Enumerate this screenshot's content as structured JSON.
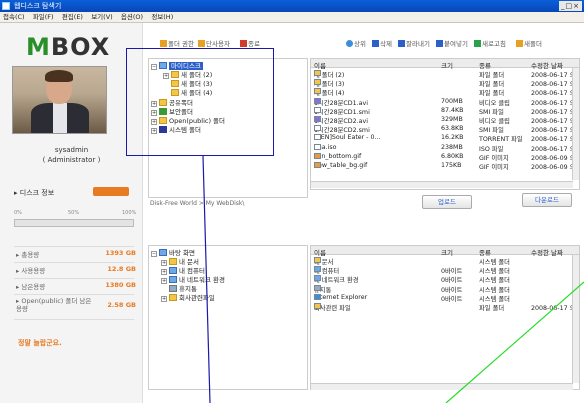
{
  "window": {
    "title": "웹디스크 탐색기",
    "controls": "_□×"
  },
  "menu": [
    "접속(C)",
    "파일(F)",
    "편집(E)",
    "보기(V)",
    "옵션(O)",
    "정보(H)"
  ],
  "sidebar": {
    "logo": "M BOX",
    "logo_m": "M",
    "logo_rest": "BOX",
    "username": "sysadmin",
    "role": "( Administrator )",
    "disk_info_label": "디스크 정보",
    "disk_info_badge": "",
    "gauge_ticks": [
      "0%",
      "50%",
      "100%"
    ],
    "gauge_fill_fraction": 0.0,
    "stats": [
      {
        "label": "총용량",
        "value": "1393 GB"
      },
      {
        "label": "사용용량",
        "value": "12.8 GB"
      },
      {
        "label": "남은용량",
        "value": "1380 GB"
      },
      {
        "label": "Open(public) 폴더 남은용량",
        "value": "2.58 GB"
      }
    ],
    "promo": "정말 놀랍군요."
  },
  "toolbar": {
    "items": [
      {
        "label": "폴더 권한",
        "icon": "folder-key-icon",
        "color": "#e8a020"
      },
      {
        "label": "단사용자",
        "icon": "user-icon",
        "color": "#e8a020"
      },
      {
        "label": "종료",
        "icon": "exit-icon",
        "color": "#d23a2a"
      },
      {
        "label": "상위",
        "icon": "up-icon",
        "color": "#3a8fd8"
      },
      {
        "label": "삭제",
        "icon": "delete-icon",
        "color": "#2b5fc9"
      },
      {
        "label": "잘라내기",
        "icon": "cut-icon",
        "color": "#2b5fc9"
      },
      {
        "label": "붙여넣기",
        "icon": "paste-icon",
        "color": "#2b5fc9"
      },
      {
        "label": "새로고침",
        "icon": "refresh-icon",
        "color": "#2ba04a"
      },
      {
        "label": "새폴더",
        "icon": "new-folder-icon",
        "color": "#e8a020"
      }
    ]
  },
  "remote_tree": {
    "items": [
      {
        "label": "마이디스크",
        "level": 0,
        "selected": true,
        "icon": "drive-icon"
      },
      {
        "label": "새 폴더 (2)",
        "level": 1,
        "icon": "folder-icon"
      },
      {
        "label": "새 폴더 (3)",
        "level": 1,
        "icon": "folder-icon"
      },
      {
        "label": "새 폴더 (4)",
        "level": 1,
        "icon": "folder-icon"
      },
      {
        "label": "공유폭더",
        "level": 0,
        "icon": "shared-folder-icon"
      },
      {
        "label": "보안폴더",
        "level": 0,
        "icon": "secure-folder-icon"
      },
      {
        "label": "Open(public) 폴더",
        "level": 0,
        "icon": "public-folder-icon"
      },
      {
        "label": "시스템 폴더",
        "level": 0,
        "icon": "system-folder-icon"
      }
    ]
  },
  "remote_files": {
    "headers": [
      "이름",
      "크기",
      "종류",
      "수정한 날짜"
    ],
    "rows": [
      {
        "name": "새 폴더 (2)",
        "size": "",
        "type": "파일 폴더",
        "date": "2008-06-17 오",
        "icon": "folder-icon"
      },
      {
        "name": "새 폴더 (3)",
        "size": "",
        "type": "파일 폴더",
        "date": "2008-06-17 오",
        "icon": "folder-icon"
      },
      {
        "name": "새 폴더 (4)",
        "size": "",
        "type": "파일 폴더",
        "date": "2008-06-17 오",
        "icon": "folder-icon"
      },
      {
        "name": "1시간28분CD1.avi",
        "size": "700MB",
        "type": "비디오 클립",
        "date": "2008-06-17 오",
        "icon": "video-icon"
      },
      {
        "name": "1시간28분CD1.smi",
        "size": "87.4KB",
        "type": "SMI 파일",
        "date": "2008-06-17 오",
        "icon": "file-icon"
      },
      {
        "name": "1시간28분CD2.avi",
        "size": "329MB",
        "type": "비디오 클립",
        "date": "2008-06-17 오",
        "icon": "video-icon"
      },
      {
        "name": "1시간28분CD2.smi",
        "size": "63.8KB",
        "type": "SMI 파일",
        "date": "2008-06-17 오",
        "icon": "file-icon"
      },
      {
        "name": "[AEN]Soul Eater - 0...",
        "size": "16.2KB",
        "type": "TORRENT 파일",
        "date": "2008-06-17 오",
        "icon": "file-icon"
      },
      {
        "name": "aaa.iso",
        "size": "238MB",
        "type": "ISO 파일",
        "date": "2008-06-17 오",
        "icon": "file-icon"
      },
      {
        "name": "con_bottom.gif",
        "size": "6.80KB",
        "type": "GIF 이미지",
        "date": "2008-06-09 오",
        "icon": "image-icon"
      },
      {
        "name": "new_table_bg.gif",
        "size": "175KB",
        "type": "GIF 이미지",
        "date": "2008-06-09 오",
        "icon": "image-icon"
      }
    ]
  },
  "path_label": "Disk-Free World > My WebDisk\\",
  "upload_label": "업로드",
  "download_label": "다운로드",
  "local_tree": {
    "items": [
      {
        "label": "바탕 화면",
        "level": 0,
        "icon": "desktop-icon"
      },
      {
        "label": "내 문서",
        "level": 1,
        "icon": "my-documents-icon"
      },
      {
        "label": "내 컴퓨터",
        "level": 1,
        "icon": "my-computer-icon"
      },
      {
        "label": "내 네트워크 환경",
        "level": 1,
        "icon": "network-icon"
      },
      {
        "label": "휴지통",
        "level": 1,
        "icon": "recycle-bin-icon"
      },
      {
        "label": "회사관련파일",
        "level": 1,
        "icon": "folder-icon"
      }
    ]
  },
  "local_files": {
    "headers": [
      "이름",
      "크기",
      "종류",
      "수정한 날짜"
    ],
    "rows": [
      {
        "name": "내 문서",
        "size": "",
        "type": "시스템 폴더",
        "date": "",
        "icon": "my-documents-icon"
      },
      {
        "name": "내 컴퓨터",
        "size": "0바이트",
        "type": "시스템 폴더",
        "date": "",
        "icon": "my-computer-icon"
      },
      {
        "name": "내 네트워크 환경",
        "size": "0바이트",
        "type": "시스템 폴더",
        "date": "",
        "icon": "network-icon"
      },
      {
        "name": "휴지통",
        "size": "0바이트",
        "type": "시스템 폴더",
        "date": "",
        "icon": "recycle-bin-icon"
      },
      {
        "name": "Internet Explorer",
        "size": "0바이트",
        "type": "시스템 폴더",
        "date": "",
        "icon": "ie-icon"
      },
      {
        "name": "회사관련 파일",
        "size": "",
        "type": "파일 폴더",
        "date": "2008-06-17 오전 (",
        "icon": "folder-icon"
      }
    ]
  }
}
